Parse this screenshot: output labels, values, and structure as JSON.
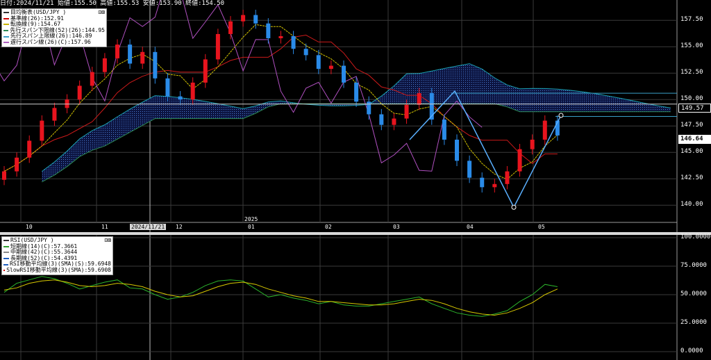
{
  "header": {
    "date_label": "日付:2024/11/21",
    "open_label": "始値:155.50",
    "high_label": "高値:155.53",
    "low_label": "安値:153.90",
    "close_label": "終値:154.50"
  },
  "legend_main": {
    "title": "目均衡表(USD/JPY )",
    "controls": "⊡⊠",
    "items": [
      {
        "label": "基準線(26):152.91",
        "color": "#cc0000"
      },
      {
        "label": "転換線(9):154.67",
        "color": "#c8b400"
      },
      {
        "label": "先行スパン下限線(52)(26):144.95",
        "color": "#2e8b57"
      },
      {
        "label": "先行スパン上限線(26):146.89",
        "color": "#3aa0c8"
      },
      {
        "label": "遅行スパン線(26)(C):157.96",
        "color": "#b060c0"
      }
    ]
  },
  "legend_rsi": {
    "title": "RSI(USD/JPY )",
    "controls": "⊡⊠",
    "items": [
      {
        "label": "短期線(14)(C):57.3661",
        "color": "#2ea02e"
      },
      {
        "label": "中期線(42)(C):55.3644",
        "color": "#8a8a8a"
      },
      {
        "label": "長期線(52)(C):54.4391",
        "color": "#1f5fbf"
      },
      {
        "label": "RSI移動平均線(3)(SMA)(S):59.6948",
        "color": "#1f5fbf"
      },
      {
        "label": "SlowRSI移動平均線(3)(SMA):59.6908",
        "color": "#cc0000"
      }
    ]
  },
  "price_axis": {
    "ticks": [
      "157.50",
      "155.00",
      "152.50",
      "150.00",
      "147.50",
      "145.00",
      "142.50",
      "140.00"
    ],
    "tick_values": [
      157.5,
      155.0,
      152.5,
      150.0,
      147.5,
      145.0,
      142.5,
      140.0
    ],
    "marker_149": "149.57",
    "current_price": "146.64"
  },
  "rsi_axis": {
    "ticks": [
      "100.0000",
      "75.0000",
      "50.0000",
      "25.0000",
      "0.0000"
    ],
    "tick_values": [
      100,
      75,
      50,
      25,
      0
    ]
  },
  "time_axis": {
    "months": [
      "10",
      "11",
      "12",
      "01",
      "02",
      "03",
      "04",
      "05"
    ],
    "year_label": "2025",
    "cursor_date": "2024/11/21"
  },
  "colors": {
    "bull": "#e8141e",
    "bear": "#2a8be8",
    "kijun": "#cc1a1a",
    "tenkan": "#d2c200",
    "chikou": "#b050c0",
    "cloud_a": "#1aa0b0",
    "cloud_b": "#2e8b57",
    "rsi": "#2cb52c",
    "rsi_ma": "#d8c800",
    "current_tag": "#ffffff",
    "marker_tag": "#000000"
  },
  "chart_data": {
    "type": "line",
    "title": "目均衡表(USD/JPY )",
    "ylim": [
      138.5,
      158.5
    ],
    "rsi_ylim": [
      0,
      100
    ],
    "series": [
      {
        "name": "USD/JPY 終値",
        "values": [
          143.2,
          144.5,
          146.1,
          148.0,
          149.2,
          150.0,
          151.3,
          152.6,
          153.9,
          155.2,
          153.4,
          154.5,
          152.0,
          150.3,
          150.0,
          151.6,
          153.8,
          156.2,
          157.4,
          158.0,
          157.2,
          155.8,
          156.0,
          154.8,
          154.2,
          152.9,
          153.2,
          151.6,
          149.8,
          148.6,
          147.6,
          148.2,
          149.5,
          150.6,
          148.1,
          146.2,
          144.2,
          142.6,
          141.7,
          142.0,
          143.2,
          145.3,
          146.2,
          148.0,
          146.6
        ]
      },
      {
        "name": "RSI",
        "values": [
          52,
          60,
          63,
          66,
          64,
          60,
          55,
          58,
          61,
          63,
          56,
          55,
          50,
          46,
          48,
          52,
          58,
          62,
          63,
          62,
          55,
          48,
          50,
          47,
          45,
          42,
          44,
          41,
          40,
          40,
          42,
          44,
          46,
          48,
          42,
          38,
          34,
          32,
          31,
          33,
          36,
          44,
          50,
          59,
          57
        ]
      },
      {
        "name": "RSI移動平均",
        "values": [
          54,
          56,
          60,
          62,
          63,
          61,
          58,
          57,
          58,
          60,
          59,
          57,
          53,
          50,
          48,
          49,
          53,
          57,
          60,
          61,
          59,
          55,
          52,
          49,
          47,
          44,
          44,
          43,
          42,
          41,
          41,
          42,
          44,
          46,
          45,
          42,
          38,
          35,
          33,
          32,
          34,
          38,
          43,
          50,
          55
        ]
      }
    ]
  }
}
